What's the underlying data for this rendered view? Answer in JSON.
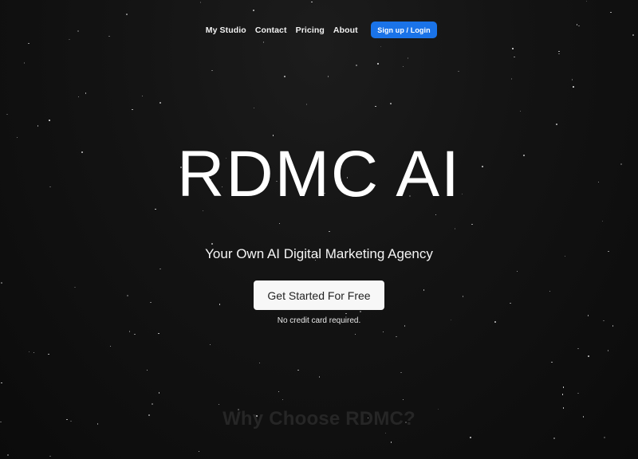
{
  "nav": {
    "links": [
      "My Studio",
      "Contact",
      "Pricing",
      "About"
    ],
    "cta_label": "Sign up / Login",
    "cta_color": "#1a73e8"
  },
  "hero": {
    "title": "RDMC AI",
    "subtitle": "Your Own AI Digital Marketing Agency",
    "cta_label": "Get Started For Free",
    "note": "No credit card required."
  },
  "features": {
    "heading": "Why Choose RDMC?"
  },
  "colors": {
    "background": "#131313",
    "text": "#ffffff",
    "accent": "#1a73e8"
  }
}
